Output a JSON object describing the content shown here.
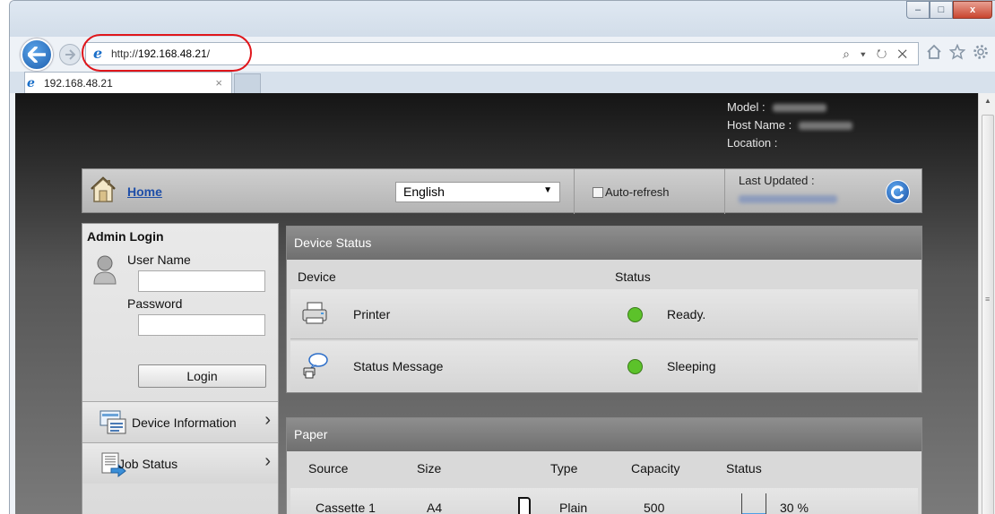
{
  "browser": {
    "window_buttons": {
      "minimize": "–",
      "maximize": "□",
      "close": "x"
    },
    "back_icon": "back-arrow-icon",
    "forward_icon": "forward-arrow-icon",
    "url_prefix": "http://",
    "url_host": "192.168.48.21",
    "url_suffix": "/",
    "address_tools": "⌕ ▾ ↻ ✕",
    "tab_title": "192.168.48.21",
    "tab_close": "×",
    "toolbar_icons": [
      "home-icon",
      "favorites-star-icon",
      "settings-gear-icon"
    ]
  },
  "device_info": {
    "model_label": "Model :",
    "host_label": "Host Name :",
    "location_label": "Location :"
  },
  "topnav": {
    "home_label": "Home",
    "language_selected": "English",
    "auto_refresh_label": "Auto-refresh",
    "auto_refresh_checked": false,
    "last_updated_label": "Last Updated :"
  },
  "admin_login": {
    "title": "Admin Login",
    "username_label": "User Name",
    "username_value": "",
    "password_label": "Password",
    "password_value": "",
    "login_button": "Login"
  },
  "left_menu": [
    {
      "label": "Device Information",
      "icon": "device-information-icon"
    },
    {
      "label": "Job Status",
      "icon": "job-status-icon"
    }
  ],
  "device_status": {
    "title": "Device Status",
    "columns": [
      "Device",
      "Status"
    ],
    "rows": [
      {
        "device": "Printer",
        "status": "Ready.",
        "icon": "printer-icon",
        "status_color": "#5cc22a"
      },
      {
        "device": "Status Message",
        "status": "Sleeping",
        "icon": "status-message-icon",
        "status_color": "#5cc22a"
      }
    ]
  },
  "paper": {
    "title": "Paper",
    "columns": [
      "Source",
      "Size",
      "Type",
      "Capacity",
      "Status"
    ],
    "rows": [
      {
        "source": "Cassette 1",
        "size": "A4",
        "type": "Plain",
        "capacity": "500",
        "status": "30 %",
        "level": 0.3
      }
    ]
  }
}
